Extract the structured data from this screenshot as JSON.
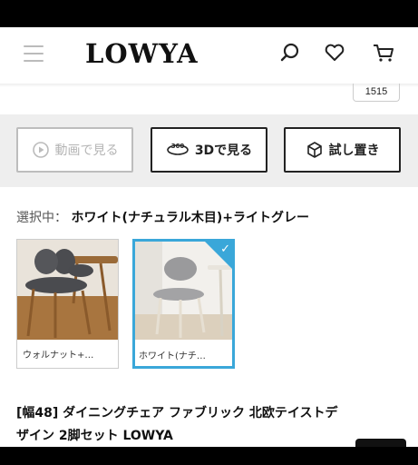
{
  "header": {
    "logo_text": "LOWYA",
    "icons": [
      "menu-icon",
      "search-icon",
      "heart-icon",
      "cart-icon"
    ]
  },
  "size_tab": {
    "label": "1515"
  },
  "buttons": {
    "video": {
      "label": "動画で見る",
      "disabled": true
    },
    "view3d": {
      "label": "3Dで見る",
      "icon_text": "360"
    },
    "place": {
      "label": "試し置き"
    }
  },
  "selection": {
    "label": "選択中：",
    "value": "ホワイト(ナチュラル木目)+ライトグレー"
  },
  "swatches": [
    {
      "caption": "ウォルナット+…",
      "selected": false
    },
    {
      "caption": "ホワイト(ナチ…",
      "selected": true
    }
  ],
  "product": {
    "title_line1": "[幅48] ダイニングチェア ファブリック 北欧テイストデ",
    "title_line2": "ザイン 2脚セット LOWYA"
  },
  "colors": {
    "accent": "#3aa7d9",
    "strip": "#eeeeee"
  }
}
